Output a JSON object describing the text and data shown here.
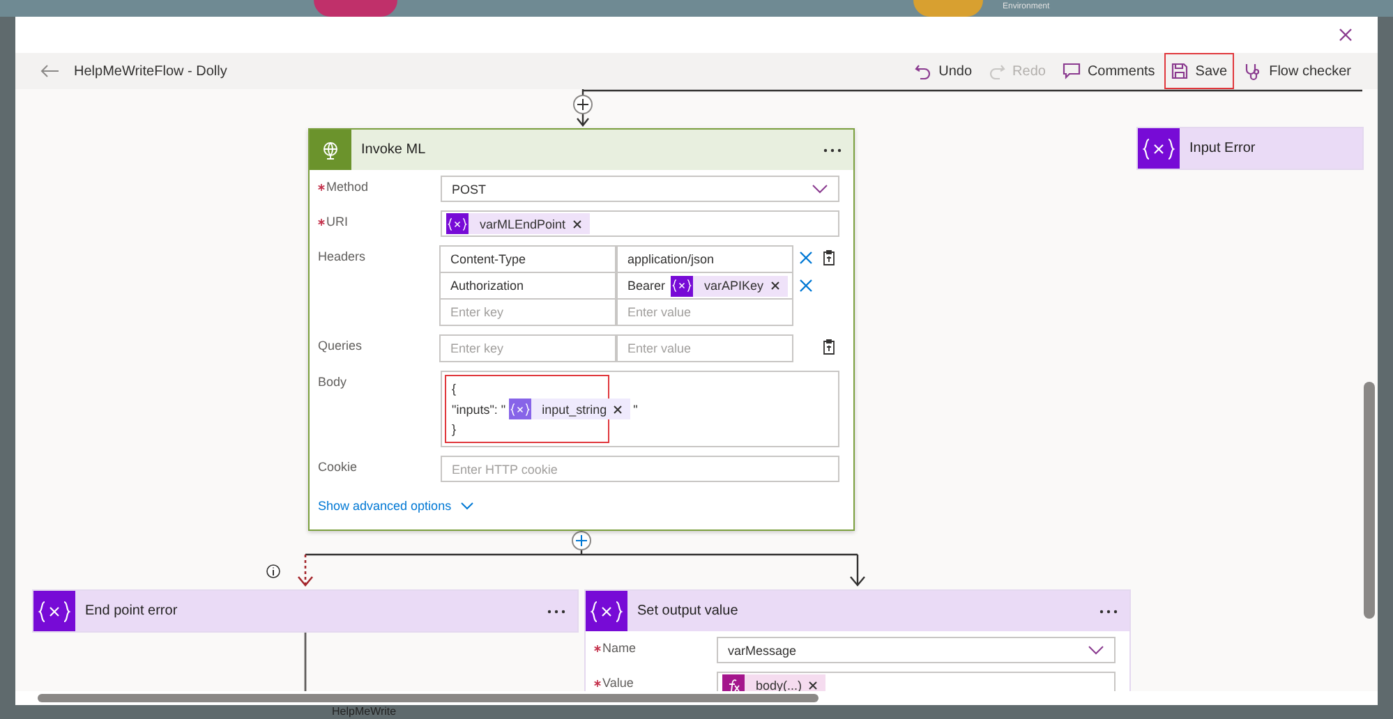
{
  "background": {
    "label": "Environment",
    "taskbar_label": "HelpMeWrite"
  },
  "toolbar": {
    "title": "HelpMeWriteFlow - Dolly",
    "actions": [
      {
        "kind": "undo",
        "label": "Undo",
        "disabled": false,
        "highlighted": false
      },
      {
        "kind": "redo",
        "label": "Redo",
        "disabled": true,
        "highlighted": false
      },
      {
        "kind": "comments",
        "label": "Comments",
        "disabled": false,
        "highlighted": false
      },
      {
        "kind": "save",
        "label": "Save",
        "disabled": false,
        "highlighted": true
      },
      {
        "kind": "checker",
        "label": "Flow checker",
        "disabled": false,
        "highlighted": false
      }
    ]
  },
  "canvas": {
    "nodes": [
      {
        "kind": "http",
        "title": "Invoke ML",
        "has_menu": true,
        "advanced_link": "Show advanced options",
        "fields": [
          {
            "kind": "dropdown",
            "label": "Method",
            "required": true,
            "value": "POST"
          },
          {
            "kind": "tokens",
            "label": "URI",
            "required": true,
            "tokens": [
              {
                "kind": "variable",
                "text": "varMLEndPoint"
              }
            ]
          },
          {
            "kind": "keyvalue",
            "label": "Headers",
            "required": false,
            "rows": [
              {
                "key": "Content-Type",
                "value": "application/json",
                "removable": true,
                "paste": true
              },
              {
                "key": "Authorization",
                "value": "Bearer",
                "token": {
                  "kind": "variable",
                  "text": "varAPIKey"
                },
                "removable": true,
                "paste": false
              },
              {
                "key_placeholder": "Enter key",
                "value_placeholder": "Enter value",
                "removable": false,
                "paste": false
              }
            ]
          },
          {
            "kind": "keyvalue",
            "label": "Queries",
            "required": false,
            "rows": [
              {
                "key_placeholder": "Enter key",
                "value_placeholder": "Enter value",
                "removable": false,
                "paste": true
              }
            ]
          },
          {
            "kind": "body",
            "label": "Body",
            "required": false,
            "highlighted": true,
            "lines": [
              {
                "before": "{"
              },
              {
                "before": "\"inputs\": \"",
                "token": {
                  "kind": "input",
                  "text": "input_string"
                },
                "after": "\""
              },
              {
                "before": "}"
              }
            ]
          },
          {
            "kind": "text",
            "label": "Cookie",
            "required": false,
            "placeholder": "Enter HTTP cookie"
          }
        ]
      },
      {
        "kind": "variable",
        "title": "Input Error",
        "has_menu": false
      },
      {
        "kind": "variable",
        "title": "End point error",
        "has_menu": true
      },
      {
        "kind": "variable",
        "title": "Set output value",
        "has_menu": true,
        "fields": [
          {
            "kind": "dropdown",
            "label": "Name",
            "required": true,
            "value": "varMessage"
          },
          {
            "kind": "tokens",
            "label": "Value",
            "required": true,
            "tokens": [
              {
                "kind": "expression",
                "text": "body(...)"
              }
            ]
          }
        ]
      }
    ]
  }
}
